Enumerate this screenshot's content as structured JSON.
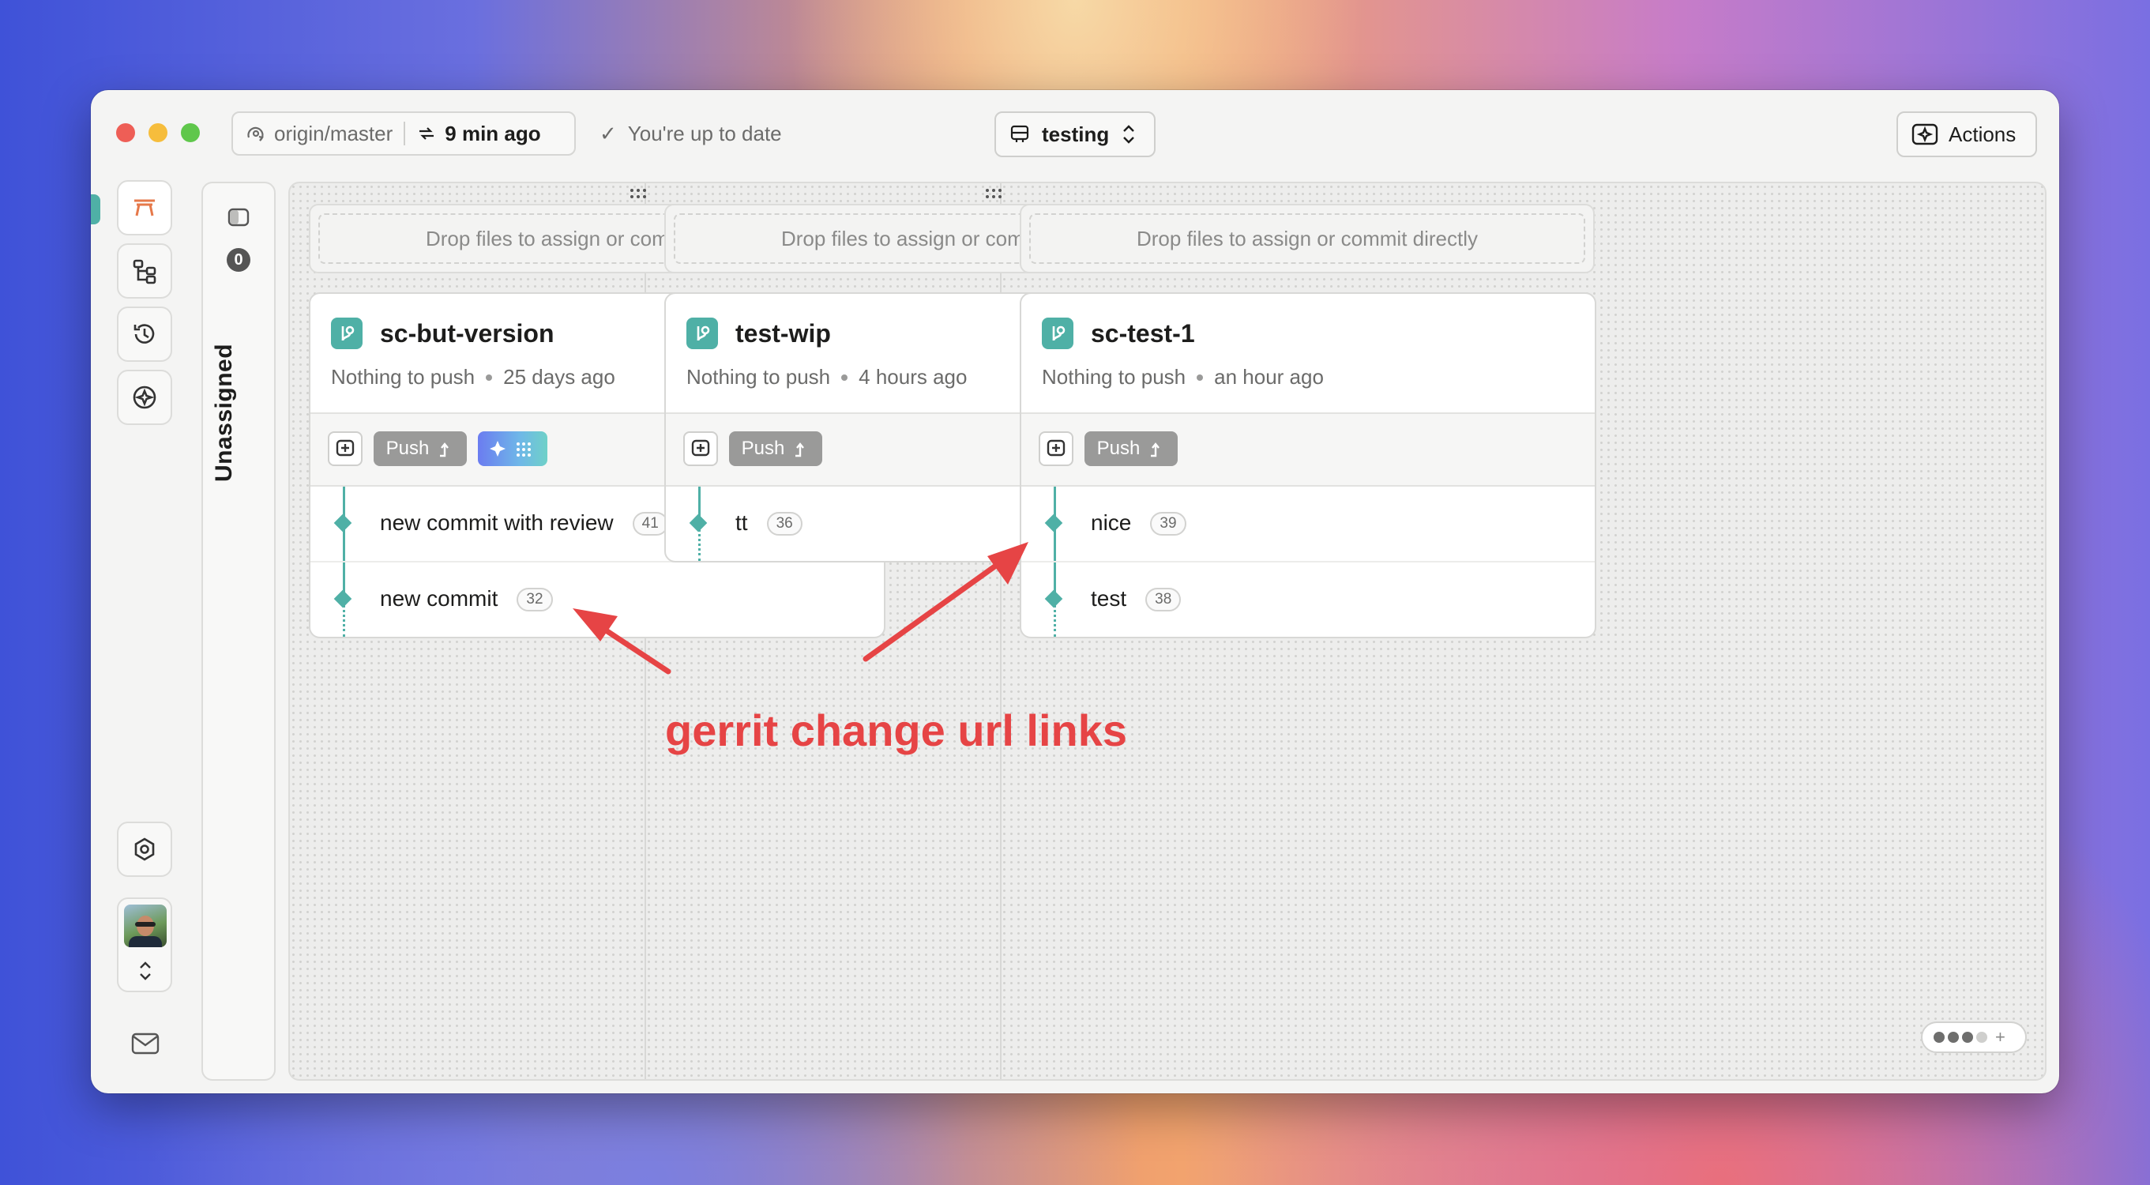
{
  "titlebar": {
    "remote_branch": "origin/master",
    "last_fetch": "9 min ago",
    "status_text": "You're up to date",
    "project_name": "testing",
    "actions_label": "Actions"
  },
  "sidebar": {
    "items": [
      {
        "name": "workspace",
        "icon": "table-icon",
        "active": true
      },
      {
        "name": "branches",
        "icon": "branches-icon"
      },
      {
        "name": "history",
        "icon": "history-icon"
      },
      {
        "name": "ai",
        "icon": "sparkle-icon"
      }
    ],
    "settings_icon": "gear-icon",
    "mail_icon": "mail-icon"
  },
  "unassigned": {
    "count": "0",
    "label": "Unassigned"
  },
  "lanes": [
    {
      "dropzone": "Drop files to assign or commit directly",
      "branch": "sc-but-version",
      "push_status": "Nothing to push",
      "updated": "25 days ago",
      "push_label": "Push",
      "has_ai": true,
      "has_more": true,
      "commits": [
        {
          "title": "new commit with review",
          "change": "41"
        },
        {
          "title": "new commit",
          "change": "32"
        }
      ]
    },
    {
      "dropzone": "Drop files to assign or commit directly",
      "branch": "test-wip",
      "push_status": "Nothing to push",
      "updated": "4 hours ago",
      "push_label": "Push",
      "has_ai": false,
      "has_more": true,
      "commits": [
        {
          "title": "tt",
          "change": "36"
        }
      ]
    },
    {
      "dropzone": "Drop files to assign or commit directly",
      "branch": "sc-test-1",
      "push_status": "Nothing to push",
      "updated": "an hour ago",
      "push_label": "Push",
      "has_ai": false,
      "has_more": false,
      "commits": [
        {
          "title": "nice",
          "change": "39"
        },
        {
          "title": "test",
          "change": "38"
        }
      ]
    }
  ],
  "annotation": {
    "text": "gerrit change url links",
    "color": "#e64445"
  },
  "colors": {
    "accent": "#4fb0a6",
    "push_button": "#9a9a99"
  }
}
